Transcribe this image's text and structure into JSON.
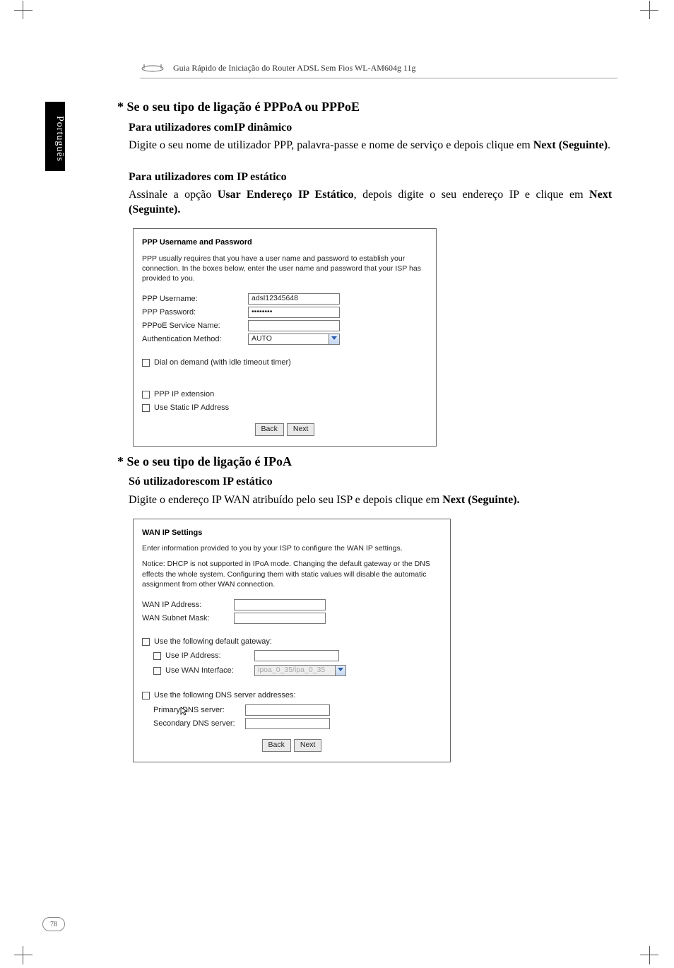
{
  "header": {
    "title": "Guia Rápido de Iniciação do Router ADSL Sem Fios WL-AM604g 11g"
  },
  "sidetab": "Português",
  "sec1": {
    "title": "* Se o seu tipo de ligação é PPPoA ou PPPoE",
    "sub1": "Para utilizadores comIP dinâmico",
    "para1a": "Digite o seu nome de utilizador PPP, palavra-passe e nome de serviço e depois clique em ",
    "para1b": "Next (Seguinte)",
    "para1c": ".",
    "sub2": "Para utilizadores com IP estático",
    "para2a": "Assinale a opção ",
    "para2b": "Usar Endereço IP Estático",
    "para2c": ", depois digite o seu endereço IP e clique em ",
    "para2d": "Next (Seguinte)."
  },
  "shot1": {
    "title": "PPP Username and Password",
    "note": "PPP usually requires that you have a user name and password to establish your connection. In the boxes below, enter the user name and password that your ISP has provided to you.",
    "r1_label": "PPP Username:",
    "r1_value": "adsl12345648",
    "r2_label": "PPP Password:",
    "r2_value": "••••••••",
    "r3_label": "PPPoE Service Name:",
    "r4_label": "Authentication Method:",
    "r4_value": "AUTO",
    "chk1": "Dial on demand (with idle timeout timer)",
    "chk2": "PPP IP extension",
    "chk3": "Use Static IP Address",
    "back": "Back",
    "next": "Next"
  },
  "sec2": {
    "title": "* Se o seu tipo de ligação é IPoA",
    "sub1": "Só utilizadorescom IP estático",
    "para1a": "Digite o endereço IP WAN atribuído pelo seu ISP e depois clique em ",
    "para1b": "Next (Seguinte)."
  },
  "shot2": {
    "title": "WAN IP Settings",
    "note1": "Enter information provided to you by your ISP to configure the WAN IP settings.",
    "note2": "Notice: DHCP is not supported in IPoA mode. Changing the default gateway or the DNS effects the whole system. Configuring them with static values will disable the automatic assignment from other WAN connection.",
    "r1": "WAN IP Address:",
    "r2": "WAN Subnet Mask:",
    "chk1": "Use the following default gateway:",
    "chk1a": "Use IP Address:",
    "chk1b": "Use WAN Interface:",
    "chk1b_val": "ipoa_0_35/ipa_0_35",
    "chk2": "Use the following DNS server addresses:",
    "r3": "Primary DNS server:",
    "r4": "Secondary DNS server:",
    "back": "Back",
    "next": "Next"
  },
  "footer": {
    "page": "78"
  }
}
